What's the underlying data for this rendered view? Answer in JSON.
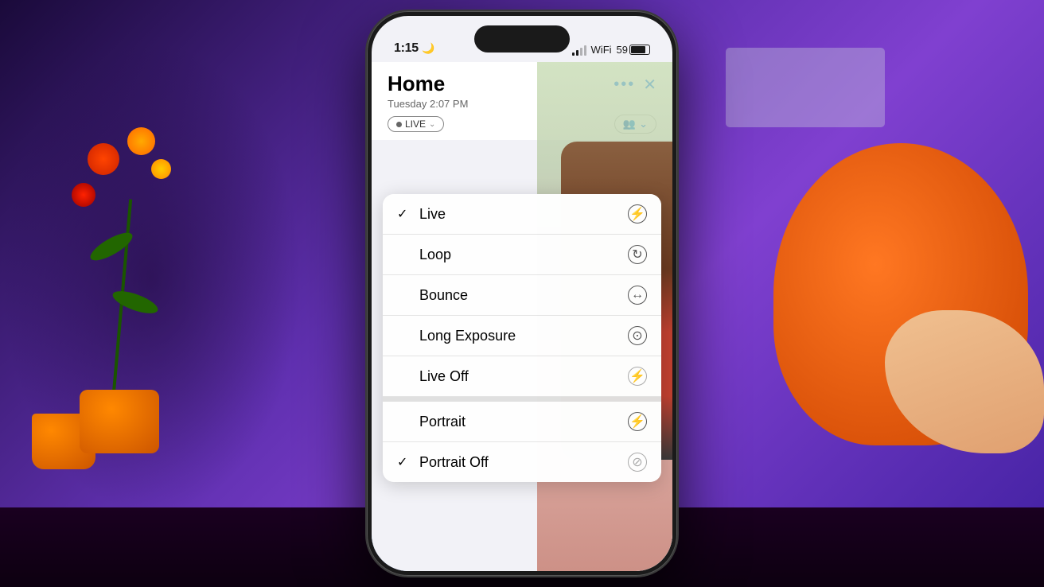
{
  "background": {
    "description": "Blurred room with purple lighting, orange chair, colorful plants"
  },
  "phone": {
    "status_bar": {
      "time": "1:15",
      "moon": "🌙",
      "battery_percent": "59",
      "battery_label": "59"
    },
    "header": {
      "title": "Home",
      "subtitle": "Tuesday  2:07 PM",
      "dots_label": "•••",
      "close_label": "✕",
      "live_badge": "LIVE",
      "live_chevron": "⌄",
      "people_icon": "👥",
      "people_chevron": "⌄"
    },
    "dropdown": {
      "items": [
        {
          "checked": true,
          "label": "Live",
          "icon": "⚡",
          "icon_type": "flash"
        },
        {
          "checked": false,
          "label": "Loop",
          "icon": "↻",
          "icon_type": "loop"
        },
        {
          "checked": false,
          "label": "Bounce",
          "icon": "↔",
          "icon_type": "bounce"
        },
        {
          "checked": false,
          "label": "Long Exposure",
          "icon": "⊙",
          "icon_type": "exposure"
        },
        {
          "checked": false,
          "label": "Live Off",
          "icon": "⚡",
          "icon_type": "flash-off"
        }
      ],
      "portrait_items": [
        {
          "checked": false,
          "label": "Portrait",
          "icon": "⚡",
          "icon_type": "flash"
        },
        {
          "checked": true,
          "label": "Portrait Off",
          "icon": "⊘",
          "icon_type": "portrait-off"
        }
      ]
    }
  }
}
